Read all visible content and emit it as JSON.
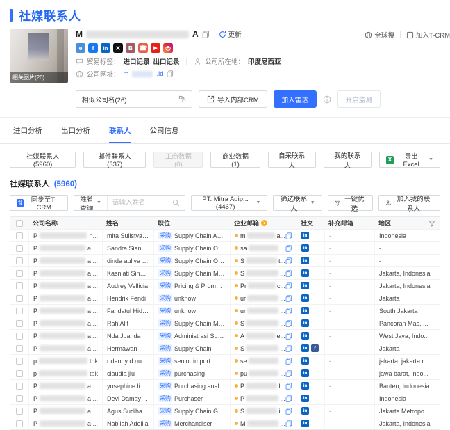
{
  "colors": {
    "accent": "#3370ff",
    "title_blue": "#2468f2",
    "linkedin": "#0a66c2",
    "facebook": "#3b5998",
    "warn_orange": "#faad14",
    "excel_green": "#1e9e5a"
  },
  "page_title": "社媒联系人",
  "company_card": {
    "photo_caption": "相关图片(20)",
    "name_prefix": "M",
    "name_suffix": "A",
    "update_label": "更新",
    "trade_label": "贸易标签：",
    "trade_tag_import": "进口记录",
    "trade_tag_export": "出口记录",
    "location_label": "公司所在地：",
    "location_value": "印度尼西亚",
    "website_label": "公司网址：",
    "website_prefix": "m",
    "website_suffix": ".id",
    "global_search_label": "全球搜",
    "join_tcrm_label": "加入T-CRM",
    "social_icons": [
      "web",
      "facebook",
      "linkedin",
      "x",
      "blog",
      "phone",
      "youtube",
      "instagram"
    ]
  },
  "action_row": {
    "similar_companies_label": "相似公司名(26)",
    "import_crm_label": "导入内部CRM",
    "join_radar_label": "加入雷达",
    "start_monitor_label": "开启监测"
  },
  "tabs": [
    {
      "label": "进口分析",
      "active": false
    },
    {
      "label": "出口分析",
      "active": false
    },
    {
      "label": "联系人",
      "active": true
    },
    {
      "label": "公司信息",
      "active": false
    }
  ],
  "subtabs": [
    {
      "label": "社媒联系人(5960)",
      "disabled": false
    },
    {
      "label": "邮件联系人(337)",
      "disabled": false
    },
    {
      "label": "工商数据(0)",
      "disabled": true
    },
    {
      "label": "商业数据(1)",
      "disabled": false
    },
    {
      "label": "自采联系人",
      "disabled": false
    },
    {
      "label": "我的联系人",
      "disabled": false
    }
  ],
  "export_excel_label": "导出 Excel",
  "section": {
    "title": "社媒联系人",
    "count": "(5960)"
  },
  "toolbar": {
    "sync_tcrm_label": "同步至T-CRM",
    "name_query_label": "姓名查询",
    "name_placeholder": "请输入姓名",
    "company_select_label": "PT. Mitra Adip...(4467)",
    "filter_contacts_label": "筛选联系人",
    "one_click_label": "一键优选",
    "add_my_contacts_label": "加入我的联系人"
  },
  "table": {
    "headers": {
      "company": "公司名称",
      "name": "姓名",
      "position": "职位",
      "email": "企业邮箱",
      "social": "社交",
      "extra_email": "补充邮箱",
      "region": "地区"
    },
    "rows": [
      {
        "company_prefix": "P",
        "company_suffix": "n...",
        "name": "mita Sulistyandari",
        "tag": "采购",
        "position": "Supply Chain Assistant Man...",
        "email_prefix": "m",
        "email_suffix": "a...",
        "social": [
          "linkedin"
        ],
        "extra_email": "-",
        "region": "Indonesia"
      },
      {
        "company_prefix": "P",
        "company_suffix": "a,...",
        "name": "Sandra Sianipar",
        "tag": "采购",
        "position": "Supply Chain Officer",
        "email_prefix": "sa",
        "email_suffix": "...",
        "social": [
          "linkedin"
        ],
        "extra_email": "-",
        "region": "-"
      },
      {
        "company_prefix": "P",
        "company_suffix": "a ...",
        "name": "dinda auliya adha",
        "tag": "采购",
        "position": "Supply Chain Officer",
        "email_prefix": "S",
        "email_suffix": "t...",
        "social": [
          "linkedin"
        ],
        "extra_email": "-",
        "region": "-"
      },
      {
        "company_prefix": "P",
        "company_suffix": "a ...",
        "name": "Kasniati Sinaga",
        "tag": "采购",
        "position": "Supply Chain Management",
        "email_prefix": "S",
        "email_suffix": "...",
        "social": [
          "linkedin"
        ],
        "extra_email": "-",
        "region": "Jakarta, Indonesia"
      },
      {
        "company_prefix": "P",
        "company_suffix": "a ...",
        "name": "Audrey Vellicia",
        "tag": "采购",
        "position": "Pricing & Promotion Execut...",
        "email_prefix": "Pr",
        "email_suffix": "c...",
        "social": [
          "linkedin"
        ],
        "extra_email": "-",
        "region": "Jakarta, Indonesia"
      },
      {
        "company_prefix": "P",
        "company_suffix": "a ...",
        "name": "Hendrik Fendi",
        "tag": "采购",
        "position": "unknow",
        "email_prefix": "ur",
        "email_suffix": "...",
        "social": [
          "linkedin"
        ],
        "extra_email": "-",
        "region": "Jakarta"
      },
      {
        "company_prefix": "P",
        "company_suffix": "a ...",
        "name": "Faridatul Hidzroh",
        "tag": "采购",
        "position": "unknow",
        "email_prefix": "ur",
        "email_suffix": "...",
        "social": [
          "linkedin"
        ],
        "extra_email": "-",
        "region": "South Jakarta"
      },
      {
        "company_prefix": "P",
        "company_suffix": "a ...",
        "name": "Rah Alif",
        "tag": "采购",
        "position": "Supply Chain Management ...",
        "email_prefix": "S",
        "email_suffix": "...",
        "social": [
          "linkedin"
        ],
        "extra_email": "-",
        "region": "Pancoran Mas, ..."
      },
      {
        "company_prefix": "P",
        "company_suffix": "a,...",
        "name": "Nda Juanda",
        "tag": "采购",
        "position": "Administrasi Supply Chain (...",
        "email_prefix": "A",
        "email_suffix": "e...",
        "social": [
          "linkedin"
        ],
        "extra_email": "-",
        "region": "West Java, Indo..."
      },
      {
        "company_prefix": "P",
        "company_suffix": "a ...",
        "name": "Hermawan Sapu...",
        "tag": "采购",
        "position": "Supply Chain",
        "email_prefix": "S",
        "email_suffix": "...",
        "social": [
          "linkedin",
          "facebook"
        ],
        "extra_email": "-",
        "region": "Jakarta"
      },
      {
        "company_prefix": "p",
        "company_suffix": "tbk",
        "name": "r danny d nurpat...",
        "tag": "采购",
        "position": "senior import",
        "email_prefix": "se",
        "email_suffix": "...",
        "social": [
          "linkedin"
        ],
        "extra_email": "-",
        "region": "jakarta, jakarta r..."
      },
      {
        "company_prefix": "p",
        "company_suffix": "tbk",
        "name": "claudia jiu",
        "tag": "采购",
        "position": "purchasing",
        "email_prefix": "pu",
        "email_suffix": "...",
        "social": [
          "linkedin"
        ],
        "extra_email": "-",
        "region": "jawa barat, indo..."
      },
      {
        "company_prefix": "P",
        "company_suffix": "a ...",
        "name": "yosephine liviane",
        "tag": "采购",
        "position": "Purchasing analysis",
        "email_prefix": "P",
        "email_suffix": "l...",
        "social": [
          "linkedin"
        ],
        "extra_email": "-",
        "region": "Banten, Indonesia"
      },
      {
        "company_prefix": "P",
        "company_suffix": "a ...",
        "name": "Devi Damayanti",
        "tag": "采购",
        "position": "Purchaser",
        "email_prefix": "P",
        "email_suffix": "...",
        "social": [
          "linkedin"
        ],
        "extra_email": "-",
        "region": "Indonesia"
      },
      {
        "company_prefix": "P",
        "company_suffix": "a ...",
        "name": "Agus Sudiharjo",
        "tag": "采购",
        "position": "Supply Chain Governance In...",
        "email_prefix": "S",
        "email_suffix": "i...",
        "social": [
          "linkedin"
        ],
        "extra_email": "-",
        "region": "Jakarta Metropo..."
      },
      {
        "company_prefix": "P",
        "company_suffix": "a ...",
        "name": "Nabilah Adellia",
        "tag": "采购",
        "position": "Merchandiser",
        "email_prefix": "M",
        "email_suffix": "...",
        "social": [
          "linkedin"
        ],
        "extra_email": "-",
        "region": "Jakarta, Indonesia"
      }
    ]
  }
}
